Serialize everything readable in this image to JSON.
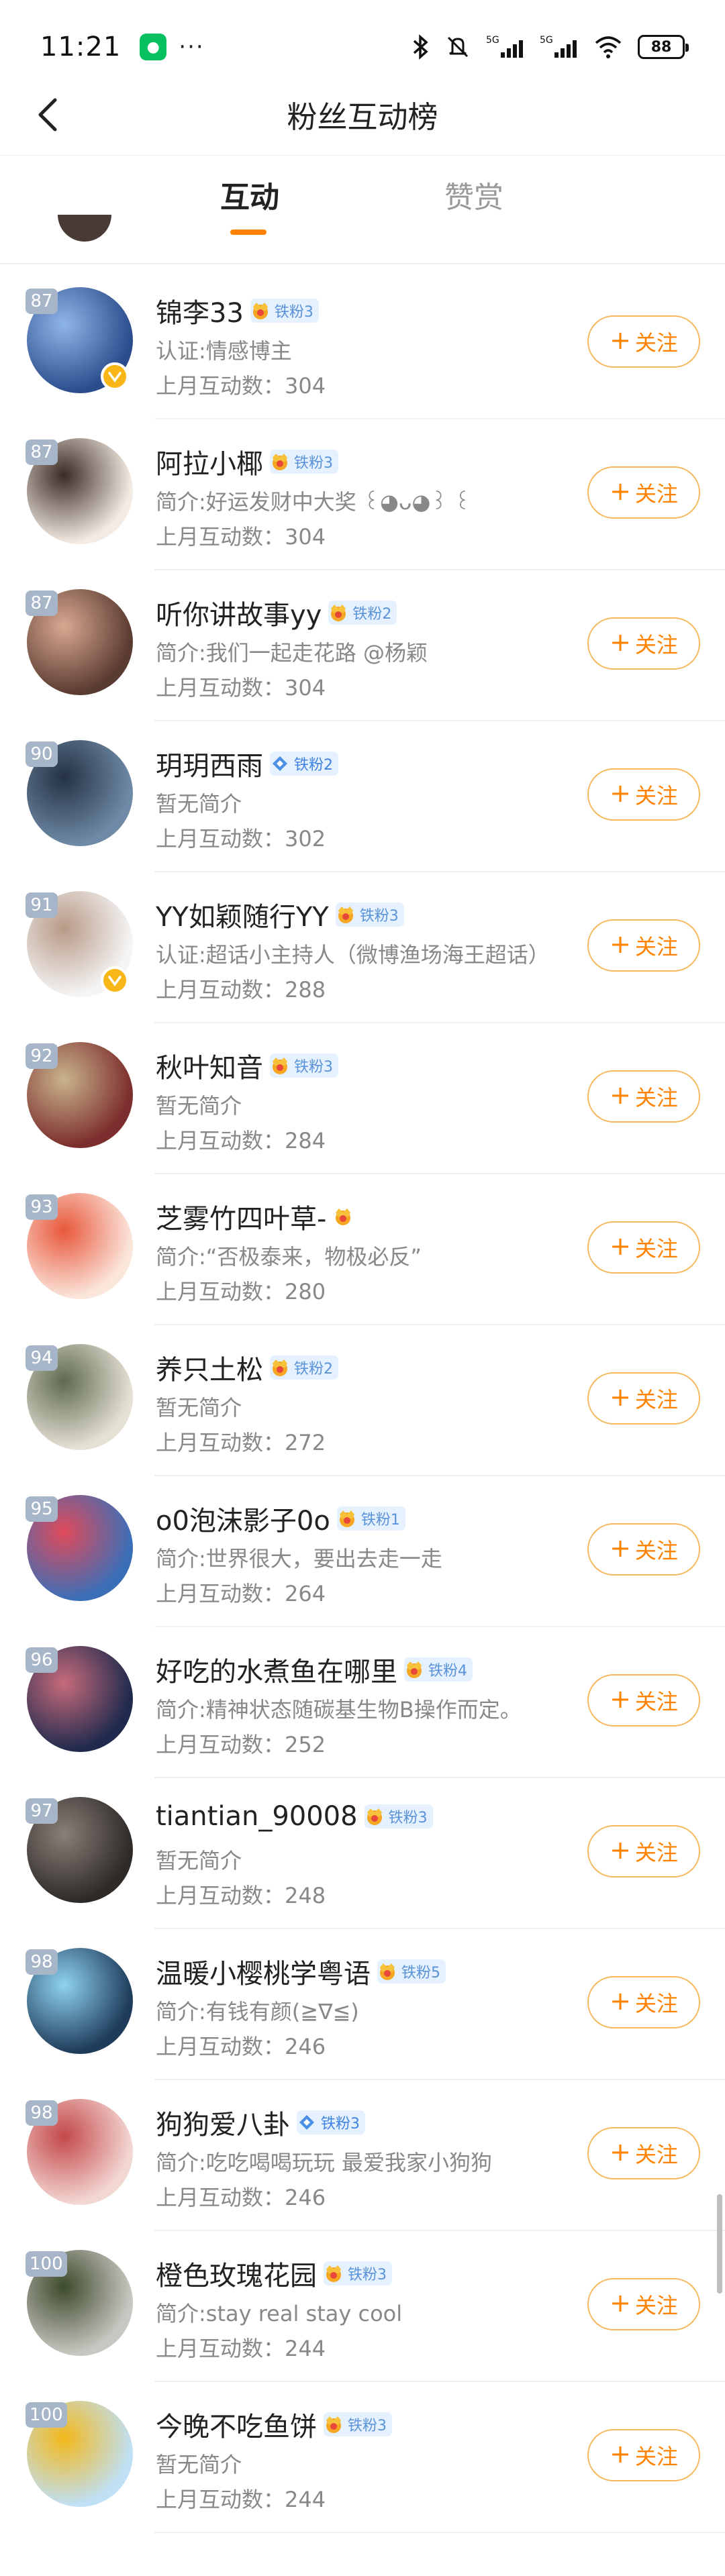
{
  "status": {
    "time": "11:21",
    "battery": "88",
    "more": "···"
  },
  "nav": {
    "title": "粉丝互动榜"
  },
  "tabs": [
    {
      "label": "互动"
    },
    {
      "label": "赞赏"
    }
  ],
  "follow_label": "关注",
  "follow_plus": "+",
  "users": [
    {
      "rank": "87",
      "name": "锦李33",
      "fan": "铁粉3",
      "desc": "认证:情感博主",
      "count": "上月互动数：304",
      "verified": true,
      "badge_color": "gold",
      "avatar_colors": [
        "#2b4d8d",
        "#8fb6e8"
      ]
    },
    {
      "rank": "87",
      "name": "阿拉小椰",
      "fan": "铁粉3",
      "desc": "简介:好运发财中大奖 ꒰◕ᴗ◕꒱ ꒰",
      "count": "上月互动数：304",
      "verified": false,
      "badge_color": "gold",
      "avatar_colors": [
        "#f4ece4",
        "#3b2b24"
      ]
    },
    {
      "rank": "87",
      "name": "听你讲故事yy",
      "fan": "铁粉2",
      "desc": "简介:我们一起走花路 @杨颖",
      "count": "上月互动数：304",
      "verified": false,
      "badge_color": "gold",
      "avatar_colors": [
        "#5a3b31",
        "#d9a891"
      ]
    },
    {
      "rank": "90",
      "name": "玥玥西雨",
      "fan": "铁粉2",
      "desc": "暂无简介",
      "count": "上月互动数：302",
      "verified": false,
      "badge_color": "blue",
      "avatar_colors": [
        "#6f8aa6",
        "#243243"
      ]
    },
    {
      "rank": "91",
      "name": "YY如颖随行YY",
      "fan": "铁粉3",
      "desc": "认证:超话小主持人（微博渔场海王超话）",
      "count": "上月互动数：288",
      "verified": true,
      "badge_color": "gold",
      "avatar_colors": [
        "#f5f5f5",
        "#b89a87"
      ]
    },
    {
      "rank": "92",
      "name": "秋叶知音",
      "fan": "铁粉3",
      "desc": "暂无简介",
      "count": "上月互动数：284",
      "verified": false,
      "badge_color": "gold",
      "avatar_colors": [
        "#7c2d2d",
        "#c9b48c"
      ]
    },
    {
      "rank": "93",
      "name": "芝雾竹四叶草-",
      "fan": "",
      "desc": "简介:“否极泰来，物极必反”",
      "count": "上月互动数：280",
      "verified": false,
      "badge_color": "gold",
      "avatar_colors": [
        "#fbe6dc",
        "#e8583b"
      ]
    },
    {
      "rank": "94",
      "name": "养只土松",
      "fan": "铁粉2",
      "desc": "暂无简介",
      "count": "上月互动数：272",
      "verified": false,
      "badge_color": "gold",
      "avatar_colors": [
        "#e6e1d5",
        "#5e6a4f"
      ]
    },
    {
      "rank": "95",
      "name": "o0泡沫影子0o",
      "fan": "铁粉1",
      "desc": "简介:世界很大，要出去走一走",
      "count": "上月互动数：264",
      "verified": false,
      "badge_color": "gold",
      "avatar_colors": [
        "#3a6fb8",
        "#e04a5a"
      ]
    },
    {
      "rank": "96",
      "name": "好吃的水煮鱼在哪里",
      "fan": "铁粉4",
      "desc": "简介:精神状态随碳基生物B操作而定。",
      "count": "上月互动数：252",
      "verified": false,
      "badge_color": "gold",
      "avatar_colors": [
        "#1f2a4d",
        "#c76b7b"
      ]
    },
    {
      "rank": "97",
      "name": "tiantian_90008",
      "fan": "铁粉3",
      "desc": "暂无简介",
      "count": "上月互动数：248",
      "verified": false,
      "badge_color": "gold",
      "avatar_colors": [
        "#2e2a28",
        "#8a7f78"
      ]
    },
    {
      "rank": "98",
      "name": "温暖小樱桃学粤语",
      "fan": "铁粉5",
      "desc": "简介:有钱有颜(≧∇≦)",
      "count": "上月互动数：246",
      "verified": false,
      "badge_color": "gold",
      "avatar_colors": [
        "#1e3b5a",
        "#8fd3f0"
      ]
    },
    {
      "rank": "98",
      "name": "狗狗爱八卦",
      "fan": "铁粉3",
      "desc": "简介:吃吃喝喝玩玩 最爱我家小狗狗",
      "count": "上月互动数：246",
      "verified": false,
      "badge_color": "blue",
      "avatar_colors": [
        "#f3d7d3",
        "#c4484a"
      ]
    },
    {
      "rank": "100",
      "name": "橙色玫瑰花园",
      "fan": "铁粉3",
      "desc": "简介:stay real stay cool",
      "count": "上月互动数：244",
      "verified": false,
      "badge_color": "gold",
      "avatar_colors": [
        "#c9c7c2",
        "#3d4a2b"
      ]
    },
    {
      "rank": "100",
      "name": "今晚不吃鱼饼",
      "fan": "铁粉3",
      "desc": "暂无简介",
      "count": "上月互动数：244",
      "verified": false,
      "badge_color": "gold",
      "avatar_colors": [
        "#bfe0f5",
        "#f3b81b"
      ]
    }
  ]
}
